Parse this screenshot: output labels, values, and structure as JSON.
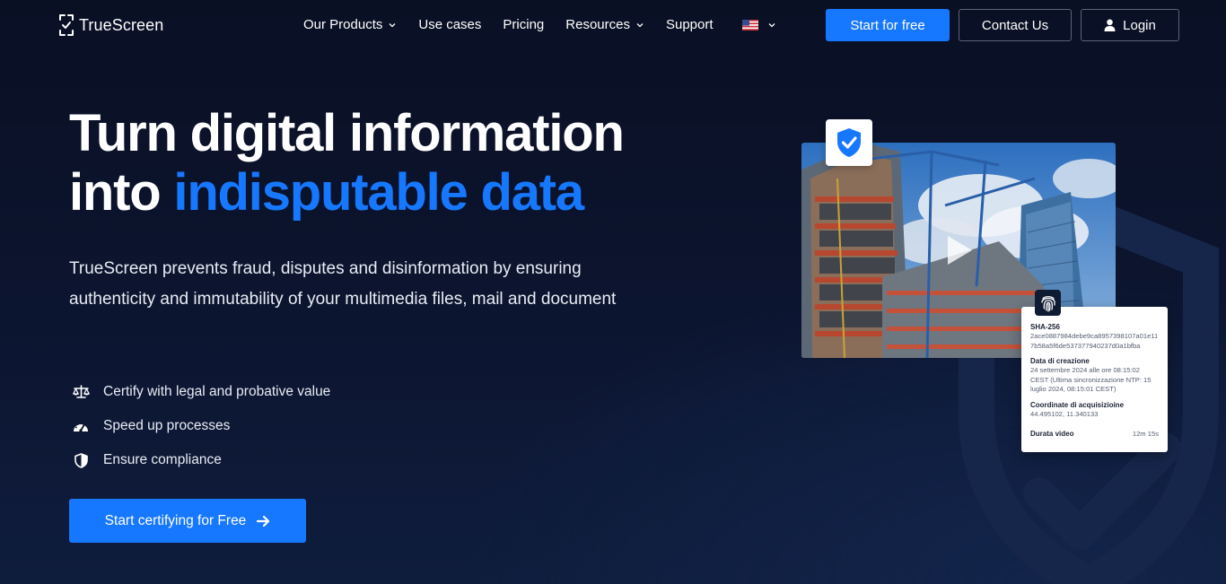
{
  "brand": {
    "name": "TrueScreen"
  },
  "nav": {
    "items": [
      {
        "label": "Our Products",
        "dropdown": true
      },
      {
        "label": "Use cases",
        "dropdown": false
      },
      {
        "label": "Pricing",
        "dropdown": false
      },
      {
        "label": "Resources",
        "dropdown": true
      },
      {
        "label": "Support",
        "dropdown": false
      }
    ],
    "language": "flag-us-icon",
    "start_label": "Start for free",
    "contact_label": "Contact Us",
    "login_label": "Login"
  },
  "hero": {
    "title_line1": "Turn digital information",
    "title_line2_prefix": "into ",
    "title_line2_accent": "indisputable data",
    "description": "TrueScreen prevents fraud, disputes and disinformation by ensuring authenticity and immutability of your multimedia files, mail and document",
    "features": [
      {
        "icon": "scales-icon",
        "label": "Certify with legal and probative value"
      },
      {
        "icon": "speedometer-icon",
        "label": "Speed up processes"
      },
      {
        "icon": "shield-half-icon",
        "label": "Ensure compliance"
      }
    ],
    "cta_label": "Start certifying for Free"
  },
  "certificate": {
    "hash_label": "SHA-256",
    "hash_value": "2ace0887984debe9ca8957398107a01e117b58a5f6de537377940237d0a1bfba",
    "date_label": "Data di creazione",
    "date_value": "24 settembre 2024 alle ore 08:15:02 CEST (Ultima sincronizzazione NTP: 15 luglio 2024, 08:15:01 CEST)",
    "coords_label": "Coordinate di acquisizioine",
    "coords_value": "44.495102, 11.340133",
    "duration_label": "Durata video",
    "duration_value": "12m 15s"
  },
  "colors": {
    "accent": "#1677ff",
    "background": "#0b1226"
  }
}
